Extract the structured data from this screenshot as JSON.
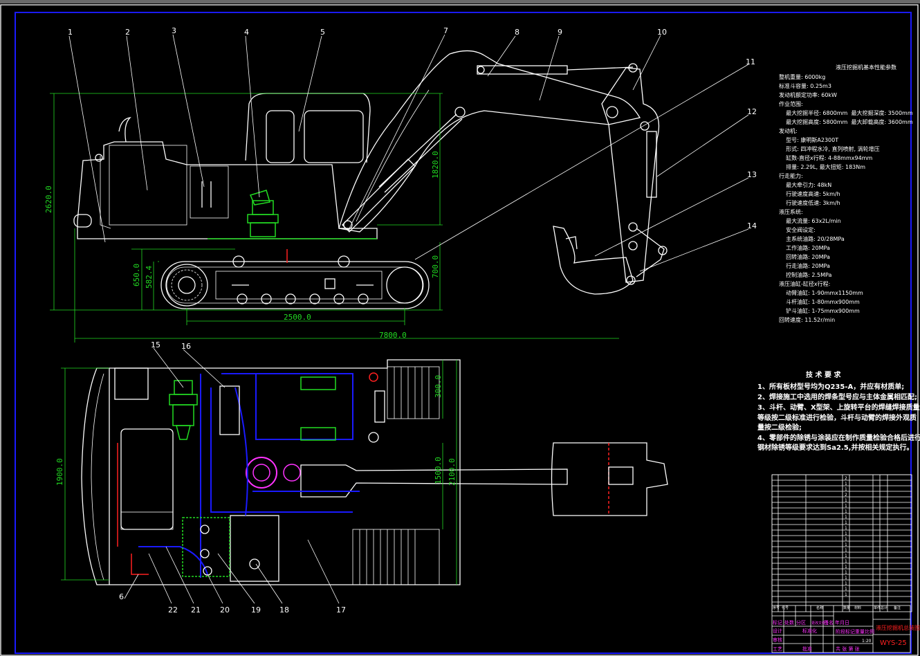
{
  "callouts": [
    "1",
    "2",
    "3",
    "4",
    "5",
    "6",
    "7",
    "8",
    "9",
    "10",
    "11",
    "12",
    "13",
    "14",
    "15",
    "16",
    "17",
    "18",
    "19",
    "20",
    "21",
    "22"
  ],
  "dimensions": {
    "height_total": "2620.0",
    "cab_height": "1820.0",
    "track_height": "650.0",
    "clearance": "582.4",
    "track_front": "700.0",
    "wheelbase": "2500.0",
    "length_total": "7800.0",
    "plan_300": "300.0",
    "plan_1500": "1500.0",
    "plan_2100": "2100.0",
    "plan_1900": "1900.0"
  },
  "params": {
    "title": "液压挖掘机基本性能参数",
    "lines": [
      "整机重量: 6000kg",
      "标准斗容量: 0.25m3",
      "发动机额定功率: 60kW",
      "作业范围:",
      "    最大挖掘半径: 6800mm  最大挖掘深度: 3500mm",
      "    最大挖掘高度: 5800mm  最大卸载高度: 3600mm",
      "发动机:",
      "    型号: 康明斯A2300T",
      "    形式: 四冲程水冷, 直列喷射, 涡轮增压",
      "    缸数-直径x行程: 4-88mmx94mm",
      "    排量: 2.29L, 最大扭矩: 183Nm",
      "行走能力:",
      "    最大牵引力: 48kN",
      "    行驶速度高速: 5km/h",
      "    行驶速度低速: 3km/h",
      "液压系统:",
      "    最大流量: 63x2L/min",
      "    安全阀设定:",
      "    主系统油路: 20/28MPa",
      "    工作油路: 20MPa",
      "    回转油路: 20MPa",
      "    行走油路: 20MPa",
      "    控制油路: 2.5MPa",
      "液压油缸-缸径x行程:",
      "    动臂油缸: 1-90mmx1150mm",
      "    斗杆油缸: 1-80mmx900mm",
      "    铲斗油缸: 1-75mmx900mm",
      "回转速度: 11.52r/min"
    ]
  },
  "requirements": {
    "title": "技 术 要 求",
    "lines": [
      "1、所有板材型号均为Q235-A，并应有材质单;",
      "2、焊接施工中选用的焊条型号应与主体金属相匹配;",
      "3、斗杆、动臂、X型架、上旋转平台的焊缝焊接质量",
      "等级按二级标准进行检验，斗杆与动臂的焊接外观质",
      "量按二级检验;",
      "4、零部件的除锈与涂装应在制作质量检验合格后进行，",
      "钢材除锈等级要求达到Sa2.5,并按相关规定执行。"
    ]
  },
  "parts_list": {
    "header": [
      "序号",
      "代号",
      "名称",
      "数量",
      "材料",
      "单件",
      "总计",
      "备注"
    ],
    "quantities": [
      "2",
      "1",
      "1",
      "2",
      "1",
      "1",
      "1",
      "1",
      "1",
      "1",
      "1",
      "1",
      "1",
      "1",
      "1",
      "1",
      "1",
      "1",
      "1",
      "1",
      "1",
      "1"
    ]
  },
  "title_block": {
    "drawing_title": "液压挖掘机总装图",
    "drawing_number": "WYS-25",
    "row_labels": [
      "标记",
      "处数",
      "分区",
      "更改文件号",
      "签名",
      "年月日"
    ],
    "designer": "设计",
    "standard": "标准化",
    "checker": "审核",
    "process": "工艺",
    "approve": "批准",
    "stage": "阶段标记",
    "weight": "重量",
    "scale": "比例",
    "scale_value": "1:20",
    "sheets": "共 张 第 张"
  },
  "colors": {
    "frame": "#1a1aff",
    "dimension": "#22dd22",
    "title": "#ff2020",
    "title_block_text": "#ff33ff"
  }
}
